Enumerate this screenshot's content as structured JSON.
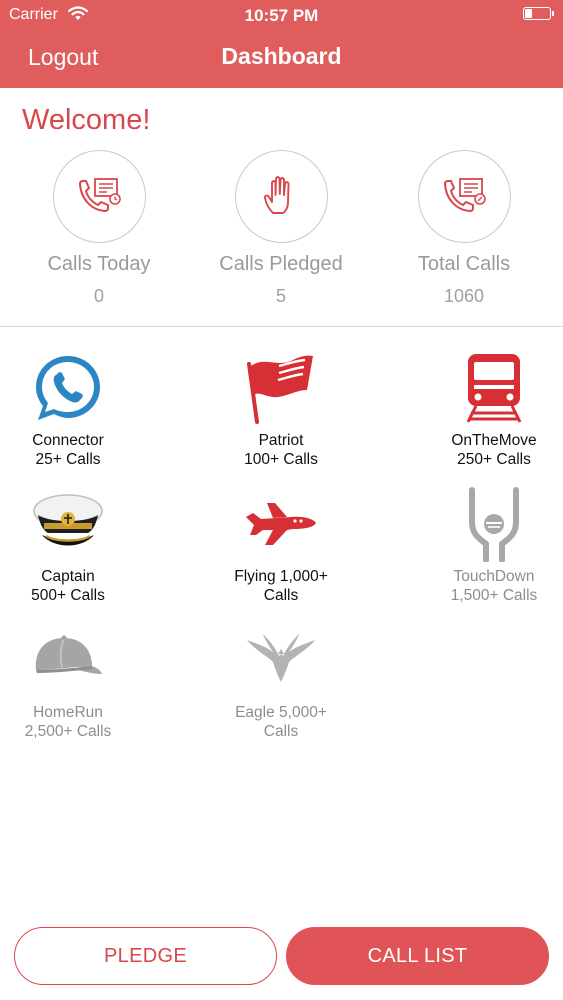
{
  "status_bar": {
    "carrier": "Carrier",
    "time": "10:57 PM"
  },
  "nav": {
    "logout_label": "Logout",
    "title": "Dashboard"
  },
  "welcome": "Welcome!",
  "stats": [
    {
      "label": "Calls Today",
      "value": "0",
      "icon": "phone-list-icon"
    },
    {
      "label": "Calls Pledged",
      "value": "5",
      "icon": "raised-hand-icon"
    },
    {
      "label": "Total Calls",
      "value": "1060",
      "icon": "phone-list-icon"
    }
  ],
  "badges": [
    {
      "name": "Connector",
      "requirement": "25+ Calls",
      "icon": "phone-bubble-icon",
      "earned": true
    },
    {
      "name": "Patriot",
      "requirement": "100+ Calls",
      "icon": "flag-icon",
      "earned": true
    },
    {
      "name": "OnTheMove",
      "requirement": "250+ Calls",
      "icon": "train-icon",
      "earned": true
    },
    {
      "name": "Captain",
      "requirement": "500+ Calls",
      "icon": "captain-hat-icon",
      "earned": true
    },
    {
      "name": "Flying 1,000+",
      "requirement": "Calls",
      "icon": "airplane-icon",
      "earned": true
    },
    {
      "name": "TouchDown",
      "requirement": "1,500+ Calls",
      "icon": "touchdown-icon",
      "earned": false
    },
    {
      "name": "HomeRun",
      "requirement": "2,500+ Calls",
      "icon": "baseball-cap-icon",
      "earned": false
    },
    {
      "name": "Eagle 5,000+",
      "requirement": "Calls",
      "icon": "eagle-icon",
      "earned": false
    }
  ],
  "buttons": {
    "pledge_label": "PLEDGE",
    "call_list_label": "CALL LIST"
  },
  "colors": {
    "accent": "#e05d5d",
    "accent_text": "#d9474b",
    "locked": "#9a9a9a"
  }
}
